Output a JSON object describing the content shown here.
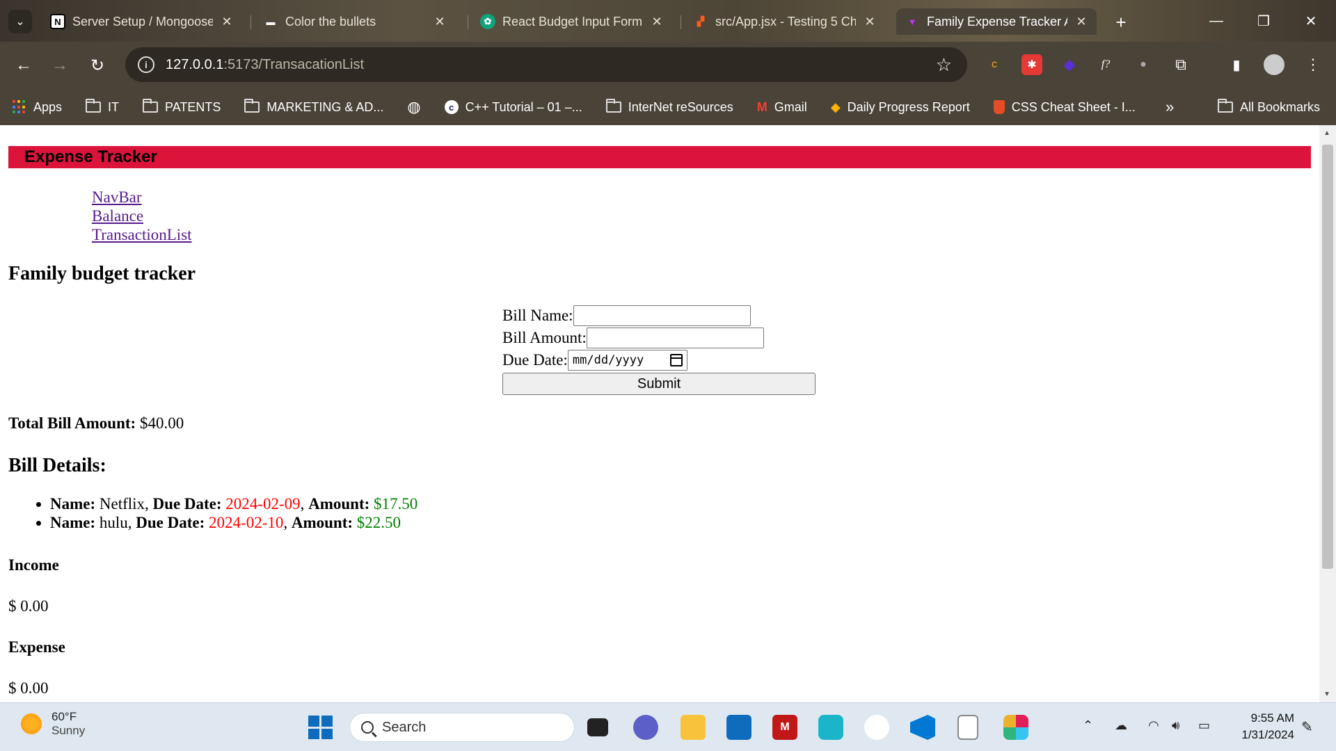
{
  "browser": {
    "tabs": [
      {
        "title": "Server Setup / Mongoose",
        "favicon": "notion-icon",
        "active": false
      },
      {
        "title": "Color the bullets",
        "favicon": "bullets-icon",
        "active": false
      },
      {
        "title": "React Budget Input Form",
        "favicon": "chatgpt-icon",
        "active": false
      },
      {
        "title": "src/App.jsx - Testing 5 Ch",
        "favicon": "codesandbox-icon",
        "active": false
      },
      {
        "title": "Family Expense Tracker A",
        "favicon": "vite-icon",
        "active": true
      }
    ],
    "url_host": "127.0.0.1",
    "url_path": ":5173/TransacationList",
    "bookmarks": [
      {
        "label": "Apps",
        "icon": "apps-grid-icon"
      },
      {
        "label": "IT",
        "icon": "folder-icon"
      },
      {
        "label": "PATENTS",
        "icon": "folder-icon"
      },
      {
        "label": "MARKETING & AD...",
        "icon": "folder-icon"
      },
      {
        "label": "",
        "icon": "globe-icon"
      },
      {
        "label": "C++ Tutorial – 01 –...",
        "icon": "cpp-icon"
      },
      {
        "label": "InterNet reSources",
        "icon": "folder-icon"
      },
      {
        "label": "Gmail",
        "icon": "gmail-icon"
      },
      {
        "label": "Daily Progress Report",
        "icon": "airtable-icon"
      },
      {
        "label": "CSS Cheat Sheet - I...",
        "icon": "html-icon"
      }
    ],
    "bookmarks_more": "»",
    "all_bookmarks": "All Bookmarks"
  },
  "page": {
    "header_title": "Expense Tracker",
    "nav_links": [
      "NavBar",
      "Balance",
      "TransactionList"
    ],
    "heading": "Family budget tracker",
    "form": {
      "bill_name_label": "Bill Name:",
      "bill_name_value": "",
      "bill_amount_label": "Bill Amount:",
      "bill_amount_value": "",
      "due_date_label": "Due Date:",
      "due_date_placeholder": "mm/dd/yyyy",
      "submit_label": "Submit"
    },
    "total_label": "Total Bill Amount:",
    "total_value": "$40.00",
    "details_heading": "Bill Details:",
    "bills": [
      {
        "name": "Netflix",
        "due": "2024-02-09",
        "amount": "$17.50"
      },
      {
        "name": "hulu",
        "due": "2024-02-10",
        "amount": "$22.50"
      }
    ],
    "bill_name_label": "Name:",
    "bill_due_label": "Due Date:",
    "bill_amount_label": "Amount:",
    "income_label": "Income",
    "income_value": "$ 0.00",
    "expense_label": "Expense",
    "expense_value": "$ 0.00",
    "colors": {
      "header_bg": "#dc143c",
      "due_date": "#ff0000",
      "amount": "#008000",
      "link": "#551a8b"
    }
  },
  "taskbar": {
    "temperature": "60°F",
    "condition": "Sunny",
    "search_placeholder": "Search",
    "time": "9:55 AM",
    "date": "1/31/2024",
    "pinned": [
      "windows-start-icon",
      "task-view-icon",
      "teams-icon",
      "file-explorer-icon",
      "store-icon",
      "mcafee-icon",
      "alexa-icon",
      "devtools-icon",
      "vscode-icon",
      "notepad-icon",
      "slack-icon"
    ]
  }
}
